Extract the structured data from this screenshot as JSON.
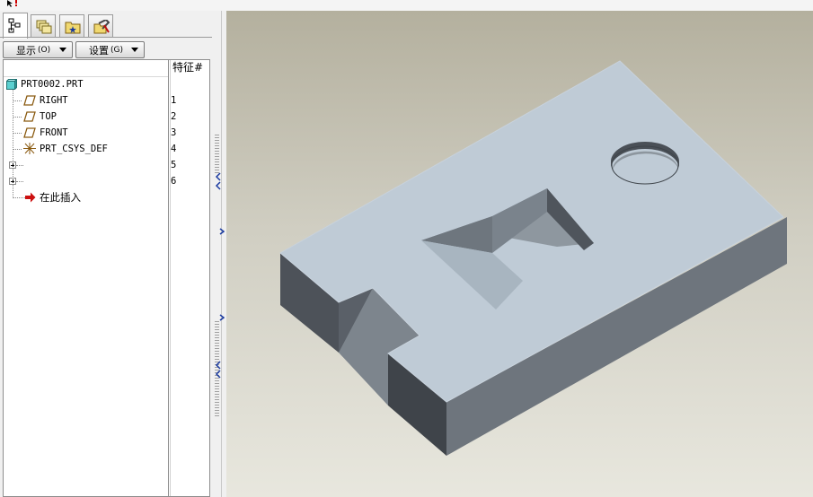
{
  "top": {
    "pointer_icon": "select-pointer-icon"
  },
  "tabs": [
    {
      "icon": "model-tree-icon",
      "active": true
    },
    {
      "icon": "layers-icon",
      "active": false
    },
    {
      "icon": "folder-star-icon",
      "active": false
    },
    {
      "icon": "favorites-tools-icon",
      "active": false
    }
  ],
  "toolbar": {
    "show_label": "显示",
    "show_accel": "(O)",
    "settings_label": "设置",
    "settings_accel": "(G)"
  },
  "tree": {
    "feature_col_header": "特征#",
    "root": {
      "label": "PRT0002.PRT",
      "icon": "part-icon"
    },
    "items": [
      {
        "label": "RIGHT",
        "icon": "datum-plane-icon",
        "number": "1"
      },
      {
        "label": "TOP",
        "icon": "datum-plane-icon",
        "number": "2"
      },
      {
        "label": "FRONT",
        "icon": "datum-plane-icon",
        "number": "3"
      },
      {
        "label": "PRT_CSYS_DEF",
        "icon": "coordinate-system-icon",
        "number": "4"
      },
      {
        "label": "",
        "icon": "expand-plus-icon",
        "number": "5"
      },
      {
        "label": "",
        "icon": "expand-plus-icon",
        "number": "6"
      }
    ],
    "insert_here": {
      "label": "在此插入",
      "icon": "red-arrow-icon"
    }
  },
  "colors": {
    "model_top": "#bfcbd6",
    "model_side_dark": "#4d5259",
    "model_side_mid": "#6e757d",
    "viewport_top": "#b4b09e",
    "viewport_bottom": "#e8e7de",
    "insert_arrow": "#cc1010"
  }
}
